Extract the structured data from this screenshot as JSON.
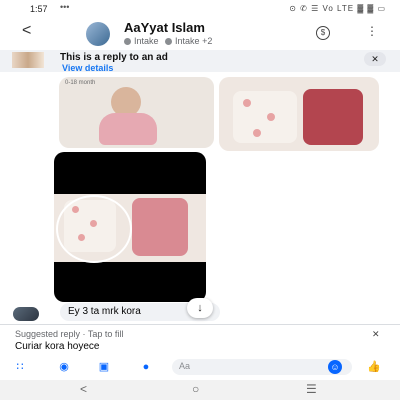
{
  "status_bar": {
    "time": "1:57",
    "indicators": "•••",
    "right_icons": "⊙ ✆ ☰ Vo LTE ▓ ▓ ▭"
  },
  "header": {
    "back_glyph": "<",
    "name": "AaYyat Islam",
    "sub1": "Intake",
    "sub2": "Intake",
    "sub_more": "+2",
    "call_glyph": "$",
    "more_glyph": "⋮"
  },
  "ad_banner": {
    "title": "This is a reply to an ad",
    "link": "View details",
    "close_glyph": "✕"
  },
  "images": {
    "img1_label": "0-18 month"
  },
  "message": {
    "text": "Ey 3 ta mrk kora"
  },
  "scroll_button": {
    "glyph": "↓"
  },
  "suggested_reply": {
    "header": "Suggested reply · Tap to fill",
    "text": "Curiar kora hoyece",
    "close_glyph": "✕"
  },
  "composer": {
    "placeholder": "Aa",
    "emoji_glyph": "☺",
    "like_glyph": "👍"
  },
  "nav_bar": {
    "back": "<",
    "home": "○",
    "recent": "☰"
  },
  "colors": {
    "accent": "#0866ff",
    "bubble": "#f0f2f5",
    "banner": "#f0f2f5"
  }
}
